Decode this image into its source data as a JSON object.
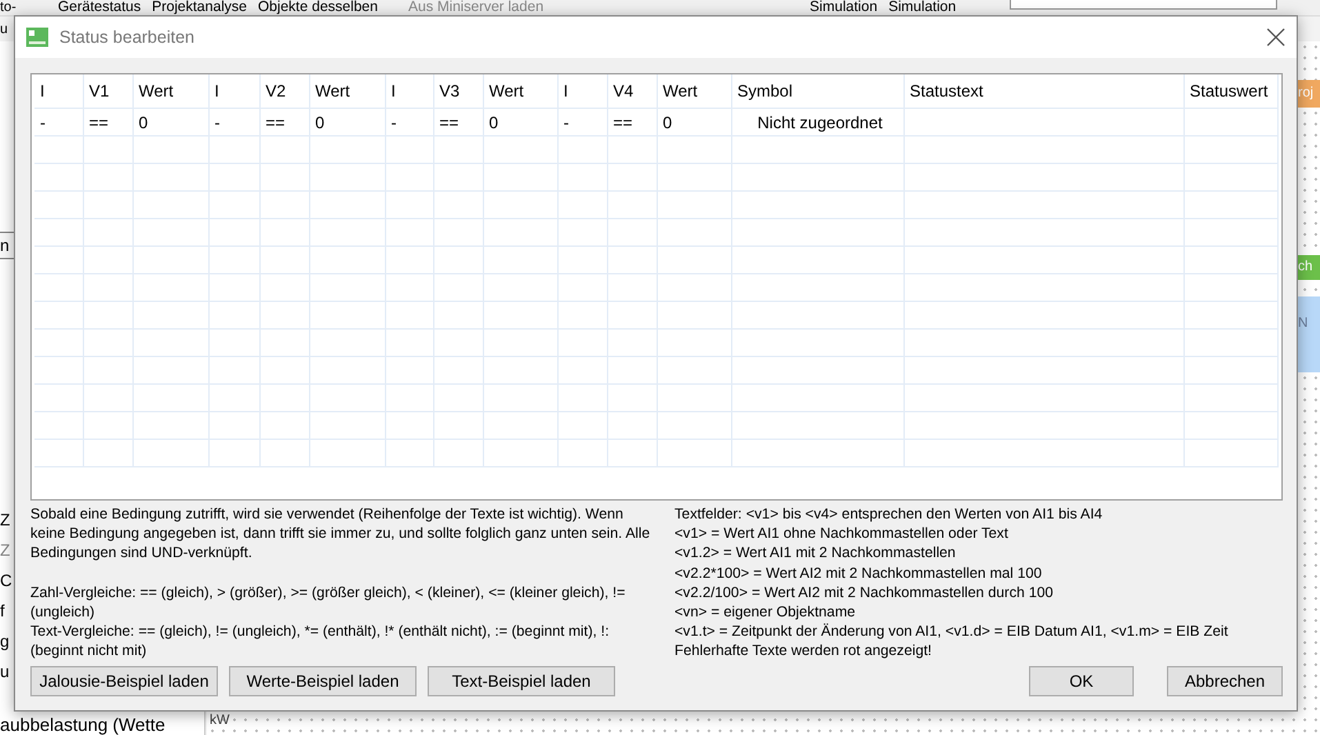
{
  "background": {
    "toolbar": [
      {
        "label": "Gerätestatus",
        "disabled": false
      },
      {
        "label": "Projektanalyse",
        "disabled": false
      },
      {
        "label": "Objekte desselben",
        "disabled": false
      },
      {
        "label": "Aus Miniserver laden",
        "disabled": true
      },
      {
        "label": "Simulation",
        "disabled": false
      },
      {
        "label": "Simulation",
        "disabled": false
      }
    ],
    "corner_lines": [
      "to-",
      "u"
    ],
    "left_tab": "n",
    "left_fragments": [
      {
        "text": "Z",
        "disabled": false
      },
      {
        "text": "Z",
        "disabled": true
      },
      {
        "text": "C",
        "disabled": false
      },
      {
        "text": "f",
        "disabled": false
      },
      {
        "text": "g",
        "disabled": false
      },
      {
        "text": "u",
        "disabled": false
      }
    ],
    "bottom_text": "aubbelastung (Wette",
    "canvas_label": "kW",
    "right_blocks": [
      {
        "text": "roj",
        "color": "#f0a860"
      },
      {
        "text": "ch",
        "color": "#6cc04a"
      },
      {
        "text": "N",
        "color": "#b8d8f8"
      }
    ]
  },
  "dialog": {
    "title": "Status bearbeiten",
    "columns": [
      "I",
      "V1",
      "Wert",
      "I",
      "V2",
      "Wert",
      "I",
      "V3",
      "Wert",
      "I",
      "V4",
      "Wert",
      "Symbol",
      "Statustext",
      "Statuswert"
    ],
    "rows": [
      [
        "-",
        "==",
        "0",
        "-",
        "==",
        "0",
        "-",
        "==",
        "0",
        "-",
        "==",
        "0",
        "Nicht zugeordnet",
        "",
        ""
      ]
    ],
    "help_left": [
      "Sobald eine Bedingung zutrifft, wird sie verwendet (Reihenfolge der Texte ist wichtig). Wenn keine Bedingung angegeben ist, dann trifft sie immer zu, und sollte folglich ganz unten sein. Alle Bedingungen sind UND-verknüpft.",
      "Zahl-Vergleiche: == (gleich), > (größer), >= (größer gleich), < (kleiner), <= (kleiner gleich), != (ungleich)",
      "Text-Vergleiche: == (gleich), != (ungleich), *= (enthält), !* (enthält nicht), := (beginnt mit), !: (beginnt nicht mit)"
    ],
    "help_right": [
      "Textfelder: <v1> bis <v4> entsprechen den Werten von AI1 bis AI4",
      "<v1> = Wert AI1 ohne Nachkommastellen oder Text",
      "<v1.2> = Wert AI1 mit 2 Nachkommastellen",
      "<v2.2*100> = Wert AI2 mit 2 Nachkommastellen mal 100",
      "<v2.2/100> = Wert AI2 mit 2 Nachkommastellen durch 100",
      "<vn> = eigener Objektname",
      "<v1.t> = Zeitpunkt der Änderung von AI1, <v1.d> = EIB Datum AI1, <v1.m> = EIB Zeit",
      "Fehlerhafte Texte werden rot angezeigt!"
    ],
    "buttons_left": [
      "Jalousie-Beispiel laden",
      "Werte-Beispiel laden",
      "Text-Beispiel laden"
    ],
    "buttons_right": [
      "OK",
      "Abbrechen"
    ]
  }
}
